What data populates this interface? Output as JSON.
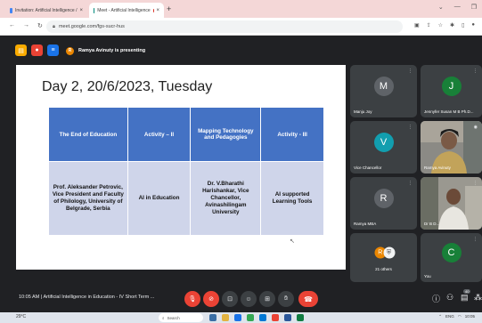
{
  "browser": {
    "tabs": [
      {
        "label": "Invitation: Artificial Intelligence /"
      },
      {
        "label": "Meet - Artificial Intelligence"
      }
    ],
    "new_tab": "+",
    "url": "meet.google.com/fgs-sucr-hus"
  },
  "presenting": {
    "presenter_initial": "R",
    "text": "Ramya Avinuty is presenting"
  },
  "slide": {
    "title": "Day 2, 20/6/2023, Tuesday",
    "headers": [
      "The End of Education",
      "Activity – II",
      "Mapping Technology and Pedagogies",
      "Activity - III"
    ],
    "cells": [
      "Prof. Aleksander Petrovic, Vice President and Faculty of Philology, University of Belgrade, Serbia",
      "AI in Education",
      "Dr. V.Bharathi Harishankar, Vice Chancellor, Avinashilingam University",
      "AI supported Learning Tools"
    ]
  },
  "participants": [
    {
      "initial": "M",
      "name": "Manju Joy",
      "color": "#5f6368"
    },
    {
      "initial": "J",
      "name": "Jennyfer Susan M B Ph.D...",
      "color": "#188038"
    },
    {
      "initial": "V",
      "name": "Vice Chancellor",
      "color": "#129eaf"
    },
    {
      "initial": "",
      "name": "Ramya Avinuty",
      "color": "#000000"
    },
    {
      "initial": "R",
      "name": "Ramya MBA",
      "color": "#5f6368"
    },
    {
      "initial": "",
      "name": "Dr B D...",
      "color": "#000000"
    },
    {
      "initial": "",
      "name": "21 others",
      "color": "#3c4043"
    },
    {
      "initial": "C",
      "name": "You",
      "color": "#188038"
    }
  ],
  "others_avatar": "R",
  "meeting": {
    "time": "10:05 AM",
    "title": "Artificial Intelligence in Education - IV Short Term ..."
  },
  "chat_badge": "40",
  "taskbar": {
    "weather": "29°C",
    "search": "Search",
    "lang": "ENG",
    "time": "10:05"
  }
}
